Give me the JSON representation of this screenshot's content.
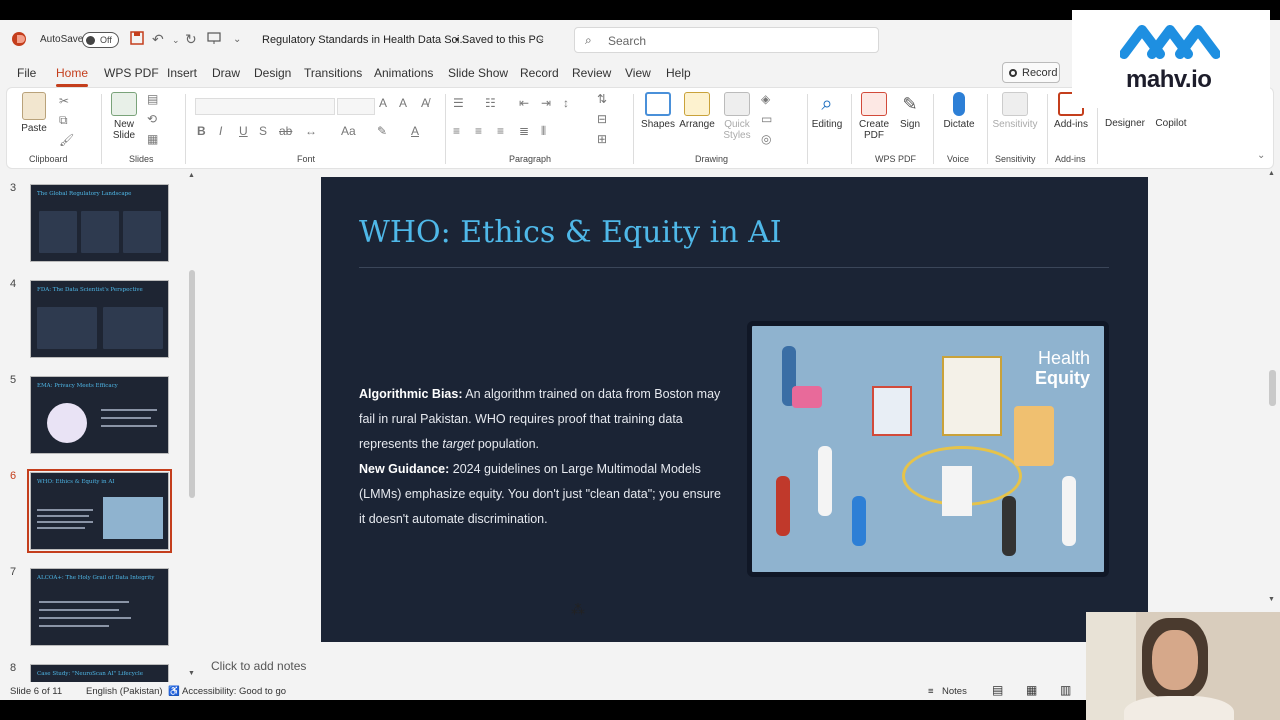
{
  "titlebar": {
    "autosave_label": "AutoSave",
    "autosave_state": "Off",
    "doc_title": "Regulatory Standards in Health Data Sci...",
    "save_status": "• Saved to this PC",
    "search_placeholder": "Search"
  },
  "menu": {
    "items": [
      "File",
      "Home",
      "WPS PDF",
      "Insert",
      "Draw",
      "Design",
      "Transitions",
      "Animations",
      "Slide Show",
      "Record",
      "Review",
      "View",
      "Help"
    ],
    "active": "Home",
    "record_label": "Record"
  },
  "ribbon": {
    "paste": "Paste",
    "clipboard": "Clipboard",
    "new_slide": "New",
    "new_slide2": "Slide",
    "slides": "Slides",
    "font": "Font",
    "paragraph": "Paragraph",
    "shapes": "Shapes",
    "arrange": "Arrange",
    "quick_styles": "Quick",
    "quick_styles2": "Styles",
    "drawing": "Drawing",
    "editing": "Editing",
    "create_pdf": "Create",
    "create_pdf2": "PDF",
    "sign": "Sign",
    "wps_pdf": "WPS PDF",
    "dictate": "Dictate",
    "voice": "Voice",
    "sensitivity": "Sensitivity",
    "sensitivity_group": "Sensitivity",
    "addins": "Add-ins",
    "addins_group": "Add-ins",
    "designer": "Designer",
    "copilot": "Copilot"
  },
  "thumbnails": [
    {
      "num": "3",
      "title": "The Global Regulatory Landscape"
    },
    {
      "num": "4",
      "title": "FDA: The Data Scientist's Perspective"
    },
    {
      "num": "5",
      "title": "EMA: Privacy Meets Efficacy"
    },
    {
      "num": "6",
      "title": "WHO: Ethics & Equity in AI"
    },
    {
      "num": "7",
      "title": "ALCOA+: The Holy Grail of Data Integrity"
    },
    {
      "num": "8",
      "title": "Case Study: \"NeuroScan AI\" Lifecycle"
    }
  ],
  "slide": {
    "title": "WHO: Ethics & Equity in AI",
    "p1_bold": "Algorithmic Bias:",
    "p1_a": " An algorithm trained on data from Boston may fail in rural Pakistan. WHO requires proof that training data represents the ",
    "p1_em": "target",
    "p1_b": " population.",
    "p2_bold": "New Guidance:",
    "p2_text": " 2024 guidelines on Large Multimodal Models (LMMs) emphasize equity. You don't just \"clean data\"; you ensure it doesn't automate discrimination.",
    "image_text_1": "Health",
    "image_text_2": "Equity"
  },
  "notes_placeholder": "Click to add notes",
  "status": {
    "slide_count": "Slide 6 of 11",
    "language": "English (Pakistan)",
    "accessibility": "Accessibility: Good to go",
    "notes": "Notes"
  },
  "brand": {
    "name": "mahv.io"
  },
  "colors": {
    "accent": "#c43e1c",
    "slide_bg": "#1b2435",
    "title_blue": "#4fb8e8",
    "brand_blue": "#1e8fe1"
  }
}
